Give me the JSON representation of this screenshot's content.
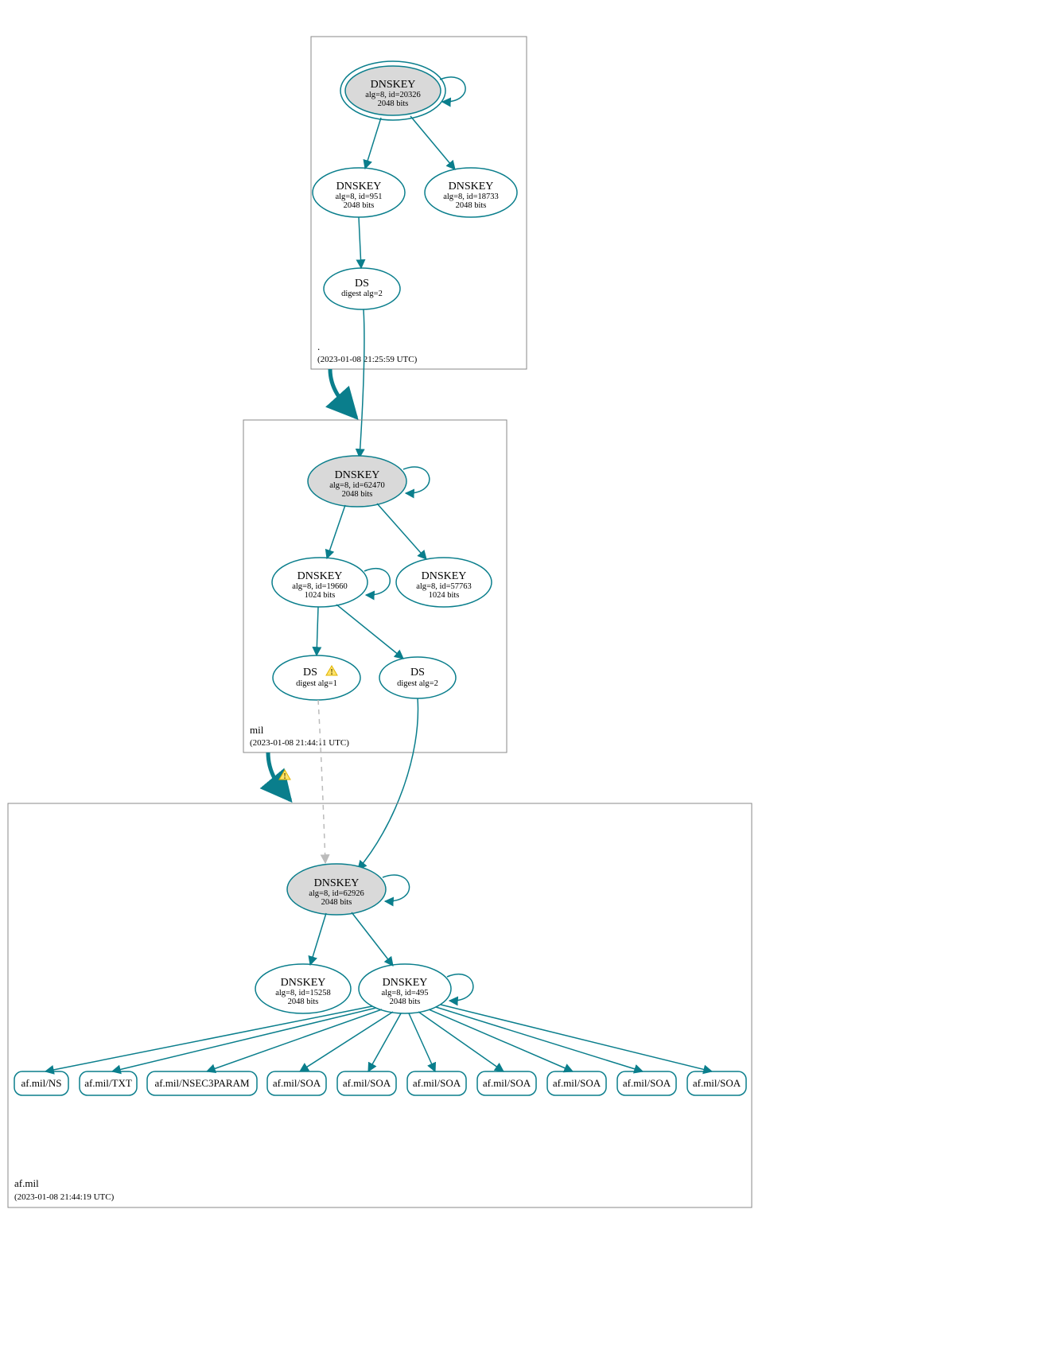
{
  "colors": {
    "stroke": "#0a7e8c",
    "kskFill": "#d9d9d9"
  },
  "zones": {
    "root": {
      "name": ".",
      "timestamp": "(2023-01-08 21:25:59 UTC)"
    },
    "mil": {
      "name": "mil",
      "timestamp": "(2023-01-08 21:44:11 UTC)"
    },
    "afmil": {
      "name": "af.mil",
      "timestamp": "(2023-01-08 21:44:19 UTC)"
    }
  },
  "nodes": {
    "root_ksk": {
      "title": "DNSKEY",
      "line2": "alg=8, id=20326",
      "line3": "2048 bits"
    },
    "root_zsk1": {
      "title": "DNSKEY",
      "line2": "alg=8, id=951",
      "line3": "2048 bits"
    },
    "root_zsk2": {
      "title": "DNSKEY",
      "line2": "alg=8, id=18733",
      "line3": "2048 bits"
    },
    "root_ds": {
      "title": "DS",
      "line2": "digest alg=2"
    },
    "mil_ksk": {
      "title": "DNSKEY",
      "line2": "alg=8, id=62470",
      "line3": "2048 bits"
    },
    "mil_zsk1": {
      "title": "DNSKEY",
      "line2": "alg=8, id=19660",
      "line3": "1024 bits"
    },
    "mil_zsk2": {
      "title": "DNSKEY",
      "line2": "alg=8, id=57763",
      "line3": "1024 bits"
    },
    "mil_ds1": {
      "title": "DS",
      "line2": "digest alg=1"
    },
    "mil_ds2": {
      "title": "DS",
      "line2": "digest alg=2"
    },
    "af_ksk": {
      "title": "DNSKEY",
      "line2": "alg=8, id=62926",
      "line3": "2048 bits"
    },
    "af_zsk1": {
      "title": "DNSKEY",
      "line2": "alg=8, id=15258",
      "line3": "2048 bits"
    },
    "af_zsk2": {
      "title": "DNSKEY",
      "line2": "alg=8, id=495",
      "line3": "2048 bits"
    }
  },
  "records": {
    "r0": "af.mil/NS",
    "r1": "af.mil/TXT",
    "r2": "af.mil/NSEC3PARAM",
    "r3": "af.mil/SOA",
    "r4": "af.mil/SOA",
    "r5": "af.mil/SOA",
    "r6": "af.mil/SOA",
    "r7": "af.mil/SOA",
    "r8": "af.mil/SOA",
    "r9": "af.mil/SOA"
  }
}
